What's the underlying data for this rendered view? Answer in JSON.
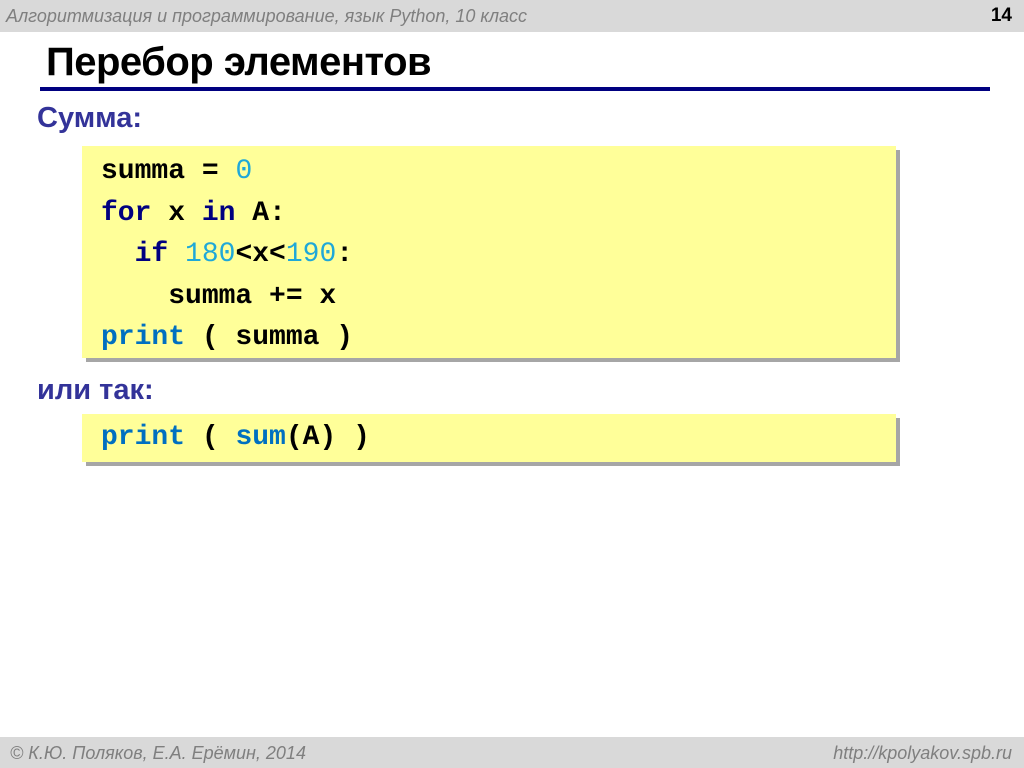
{
  "header": {
    "course": "Алгоритмизация и программирование, язык Python, 10 класс",
    "page_number": "14"
  },
  "slide": {
    "title": "Перебор элементов",
    "heading_sum": "Сумма:",
    "heading_alt": "или так:",
    "code_block_1": [
      [
        {
          "t": "summa",
          "c": "plain"
        },
        {
          "t": " = ",
          "c": "plain"
        },
        {
          "t": "0",
          "c": "num"
        }
      ],
      [
        {
          "t": "for",
          "c": "kw"
        },
        {
          "t": " x ",
          "c": "plain"
        },
        {
          "t": "in",
          "c": "kw"
        },
        {
          "t": " A:",
          "c": "plain"
        }
      ],
      [
        {
          "t": "  ",
          "c": "plain"
        },
        {
          "t": "if",
          "c": "kw"
        },
        {
          "t": " ",
          "c": "plain"
        },
        {
          "t": "180",
          "c": "num"
        },
        {
          "t": "<x<",
          "c": "plain"
        },
        {
          "t": "190",
          "c": "num"
        },
        {
          "t": ":",
          "c": "plain"
        }
      ],
      [
        {
          "t": "    summa += x",
          "c": "plain"
        }
      ],
      [
        {
          "t": "print",
          "c": "fn"
        },
        {
          "t": " ( summa )",
          "c": "plain"
        }
      ]
    ],
    "code_block_2": [
      [
        {
          "t": "print",
          "c": "fn"
        },
        {
          "t": " ( ",
          "c": "plain"
        },
        {
          "t": "sum",
          "c": "fn"
        },
        {
          "t": "(A) )",
          "c": "plain"
        }
      ]
    ]
  },
  "footer": {
    "copyright": "© К.Ю. Поляков, Е.А. Ерёмин, 2014",
    "url": "http://kpolyakov.spb.ru"
  },
  "colors": {
    "rule": "#000080",
    "heading": "#333399",
    "code_bg": "#ffff99",
    "keyword": "#000080",
    "function": "#0070c0",
    "number": "#1fa8d8"
  }
}
